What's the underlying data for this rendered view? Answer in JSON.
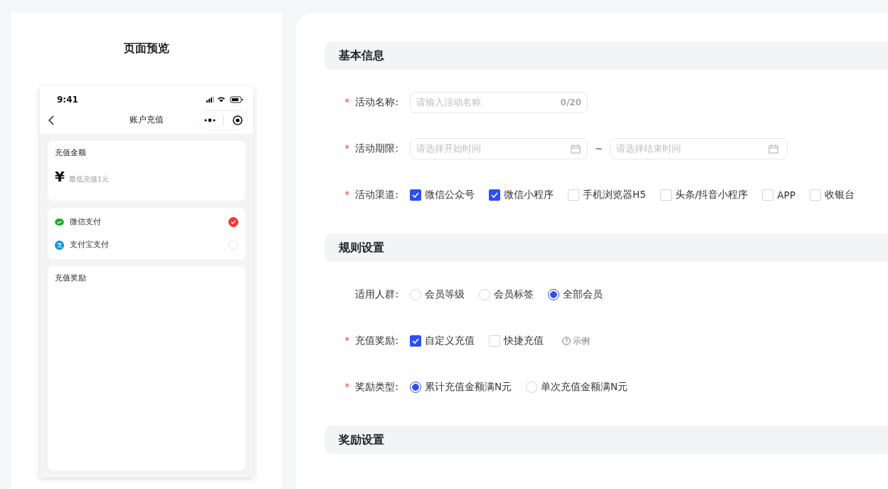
{
  "preview": {
    "title": "页面预览",
    "phone": {
      "time": "9:41",
      "nav_title": "账户充值",
      "amount_card": {
        "title": "充值金额",
        "currency": "¥",
        "placeholder": "最低充值1元"
      },
      "payments": [
        {
          "kind": "wechat",
          "name": "微信支付",
          "selected": true
        },
        {
          "kind": "alipay",
          "name": "支付宝支付",
          "selected": false
        }
      ],
      "reward_card": {
        "title": "充值奖励"
      }
    }
  },
  "sections": [
    {
      "title": "基本信息",
      "fields": [
        {
          "kind": "text",
          "label": "活动名称:",
          "required_mark": "*",
          "placeholder": "请输入活动名称",
          "counter": "0/20"
        },
        {
          "kind": "daterange",
          "label": "活动期限:",
          "required_mark": "*",
          "start_placeholder": "请选择开始时间",
          "separator": "~",
          "end_placeholder": "请选择结束时间"
        },
        {
          "kind": "checkbox",
          "label": "活动渠道:",
          "required_mark": "*",
          "options": [
            {
              "label": "微信公众号",
              "checked": true
            },
            {
              "label": "微信小程序",
              "checked": true
            },
            {
              "label": "手机浏览器H5",
              "checked": false
            },
            {
              "label": "头条/抖音小程序",
              "checked": false
            },
            {
              "label": "APP",
              "checked": false
            },
            {
              "label": "收银台",
              "checked": false
            }
          ]
        }
      ]
    },
    {
      "title": "规则设置",
      "fields": [
        {
          "kind": "radio",
          "label": "适用人群:",
          "options": [
            {
              "label": "会员等级",
              "selected": false
            },
            {
              "label": "会员标签",
              "selected": false
            },
            {
              "label": "全部会员",
              "selected": true
            }
          ]
        },
        {
          "kind": "checkbox",
          "label": "充值奖励:",
          "required_mark": "*",
          "options": [
            {
              "label": "自定义充值",
              "checked": true
            },
            {
              "label": "快捷充值",
              "checked": false
            }
          ],
          "help": "示例"
        },
        {
          "kind": "radio",
          "label": "奖励类型:",
          "required_mark": "*",
          "options": [
            {
              "label": "累计充值金额满N元",
              "selected": true
            },
            {
              "label": "单次充值金额满N元",
              "selected": false
            }
          ]
        }
      ]
    },
    {
      "title": "奖励设置"
    }
  ]
}
